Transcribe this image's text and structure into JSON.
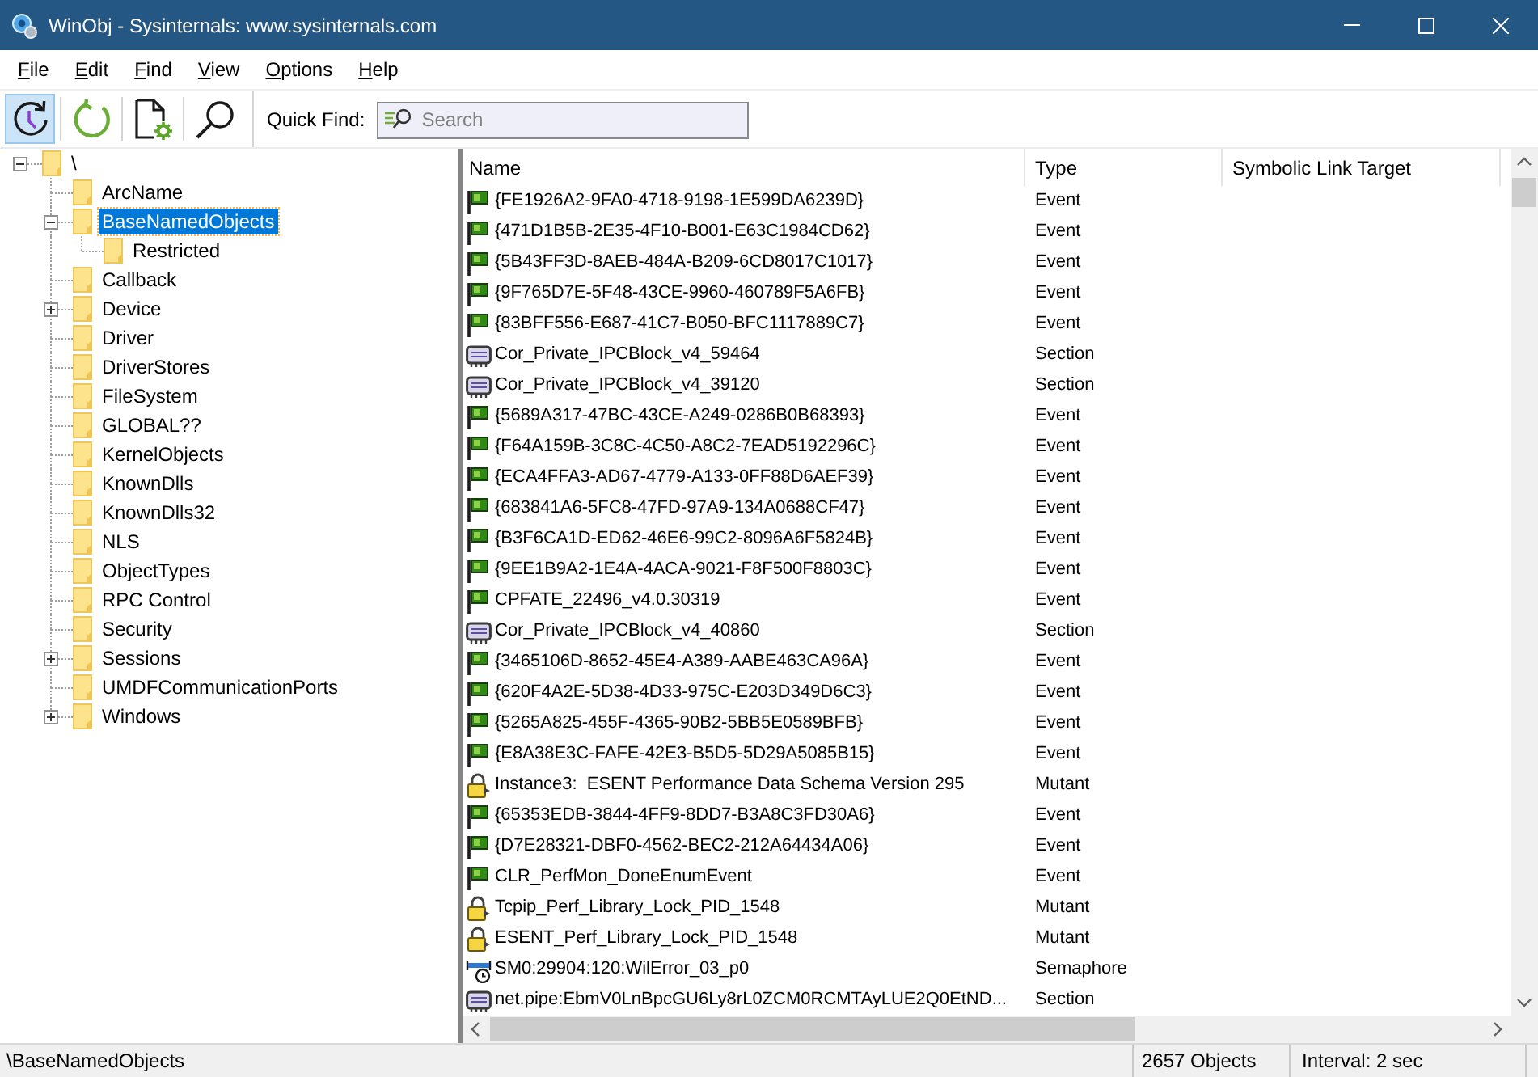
{
  "window": {
    "title": "WinObj - Sysinternals: www.sysinternals.com"
  },
  "menu": [
    "File",
    "Edit",
    "Find",
    "View",
    "Options",
    "Help"
  ],
  "toolbar": {
    "buttons": [
      {
        "kind": "auto_refresh",
        "pressed": true
      },
      {
        "kind": "refresh",
        "pressed": false
      },
      {
        "kind": "properties",
        "pressed": false
      },
      {
        "kind": "find",
        "pressed": false
      }
    ],
    "quick_find": {
      "label": "Quick Find:",
      "placeholder": "Search"
    }
  },
  "tree": {
    "items": [
      {
        "label": "\\",
        "expanded": true,
        "selected": false,
        "children": [
          {
            "label": "ArcName",
            "selected": false
          },
          {
            "label": "BaseNamedObjects",
            "expanded": true,
            "selected": true,
            "children": [
              {
                "label": "Restricted",
                "selected": false
              }
            ]
          },
          {
            "label": "Callback",
            "selected": false
          },
          {
            "label": "Device",
            "expanded": false,
            "selected": false
          },
          {
            "label": "Driver",
            "selected": false
          },
          {
            "label": "DriverStores",
            "selected": false
          },
          {
            "label": "FileSystem",
            "selected": false
          },
          {
            "label": "GLOBAL??",
            "selected": false
          },
          {
            "label": "KernelObjects",
            "selected": false
          },
          {
            "label": "KnownDlls",
            "selected": false
          },
          {
            "label": "KnownDlls32",
            "selected": false
          },
          {
            "label": "NLS",
            "selected": false
          },
          {
            "label": "ObjectTypes",
            "selected": false
          },
          {
            "label": "RPC Control",
            "selected": false
          },
          {
            "label": "Security",
            "selected": false
          },
          {
            "label": "Sessions",
            "expanded": false,
            "selected": false
          },
          {
            "label": "UMDFCommunicationPorts",
            "selected": false
          },
          {
            "label": "Windows",
            "expanded": false,
            "selected": false
          }
        ]
      }
    ]
  },
  "list": {
    "columns": [
      "Name",
      "Type",
      "Symbolic Link Target"
    ],
    "rows": [
      {
        "kind": "event",
        "name": "{FE1926A2-9FA0-4718-9198-1E599DA6239D}",
        "type": "Event",
        "selected": false
      },
      {
        "kind": "event",
        "name": "{471D1B5B-2E35-4F10-B001-E63C1984CD62}",
        "type": "Event",
        "selected": false
      },
      {
        "kind": "event",
        "name": "{5B43FF3D-8AEB-484A-B209-6CD8017C1017}",
        "type": "Event",
        "selected": false
      },
      {
        "kind": "event",
        "name": "{9F765D7E-5F48-43CE-9960-460789F5A6FB}",
        "type": "Event",
        "selected": false
      },
      {
        "kind": "event",
        "name": "{83BFF556-E687-41C7-B050-BFC1117889C7}",
        "type": "Event",
        "selected": false
      },
      {
        "kind": "section",
        "name": "Cor_Private_IPCBlock_v4_59464",
        "type": "Section",
        "selected": false
      },
      {
        "kind": "section",
        "name": "Cor_Private_IPCBlock_v4_39120",
        "type": "Section",
        "selected": false
      },
      {
        "kind": "event",
        "name": "{5689A317-47BC-43CE-A249-0286B0B68393}",
        "type": "Event",
        "selected": false
      },
      {
        "kind": "event",
        "name": "{F64A159B-3C8C-4C50-A8C2-7EAD5192296C}",
        "type": "Event",
        "selected": false
      },
      {
        "kind": "event",
        "name": "{ECA4FFA3-AD67-4779-A133-0FF88D6AEF39}",
        "type": "Event",
        "selected": false
      },
      {
        "kind": "event",
        "name": "{683841A6-5FC8-47FD-97A9-134A0688CF47}",
        "type": "Event",
        "selected": false
      },
      {
        "kind": "event",
        "name": "{B3F6CA1D-ED62-46E6-99C2-8096A6F5824B}",
        "type": "Event",
        "selected": false
      },
      {
        "kind": "event",
        "name": "{9EE1B9A2-1E4A-4ACA-9021-F8F500F8803C}",
        "type": "Event",
        "selected": false
      },
      {
        "kind": "event",
        "name": "CPFATE_22496_v4.0.30319",
        "type": "Event",
        "selected": false
      },
      {
        "kind": "section",
        "name": "Cor_Private_IPCBlock_v4_40860",
        "type": "Section",
        "selected": false
      },
      {
        "kind": "event",
        "name": "{3465106D-8652-45E4-A389-AABE463CA96A}",
        "type": "Event",
        "selected": false
      },
      {
        "kind": "event",
        "name": "{620F4A2E-5D38-4D33-975C-E203D349D6C3}",
        "type": "Event",
        "selected": false
      },
      {
        "kind": "event",
        "name": "{5265A825-455F-4365-90B2-5BB5E0589BFB}",
        "type": "Event",
        "selected": false
      },
      {
        "kind": "event",
        "name": "{E8A38E3C-FAFE-42E3-B5D5-5D29A5085B15}",
        "type": "Event",
        "selected": false
      },
      {
        "kind": "mutant",
        "name": "Instance3:  ESENT Performance Data Schema Version 295",
        "type": "Mutant",
        "selected": false
      },
      {
        "kind": "event",
        "name": "{65353EDB-3844-4FF9-8DD7-B3A8C3FD30A6}",
        "type": "Event",
        "selected": false
      },
      {
        "kind": "event",
        "name": "{D7E28321-DBF0-4562-BEC2-212A64434A06}",
        "type": "Event",
        "selected": false
      },
      {
        "kind": "event",
        "name": "CLR_PerfMon_DoneEnumEvent",
        "type": "Event",
        "selected": false
      },
      {
        "kind": "mutant",
        "name": "Tcpip_Perf_Library_Lock_PID_1548",
        "type": "Mutant",
        "selected": false
      },
      {
        "kind": "mutant",
        "name": "ESENT_Perf_Library_Lock_PID_1548",
        "type": "Mutant",
        "selected": false
      },
      {
        "kind": "semaphore",
        "name": "SM0:29904:120:WilError_03_p0",
        "type": "Semaphore",
        "selected": false
      },
      {
        "kind": "section",
        "name": "net.pipe:EbmV0LnBpcGU6Ly8rL0ZCM0RCMTAyLUE2Q0EtND...",
        "type": "Section",
        "selected": false
      }
    ]
  },
  "status_bar": {
    "path": "\\BaseNamedObjects",
    "count": "2657 Objects",
    "interval": "Interval: 2 sec"
  }
}
